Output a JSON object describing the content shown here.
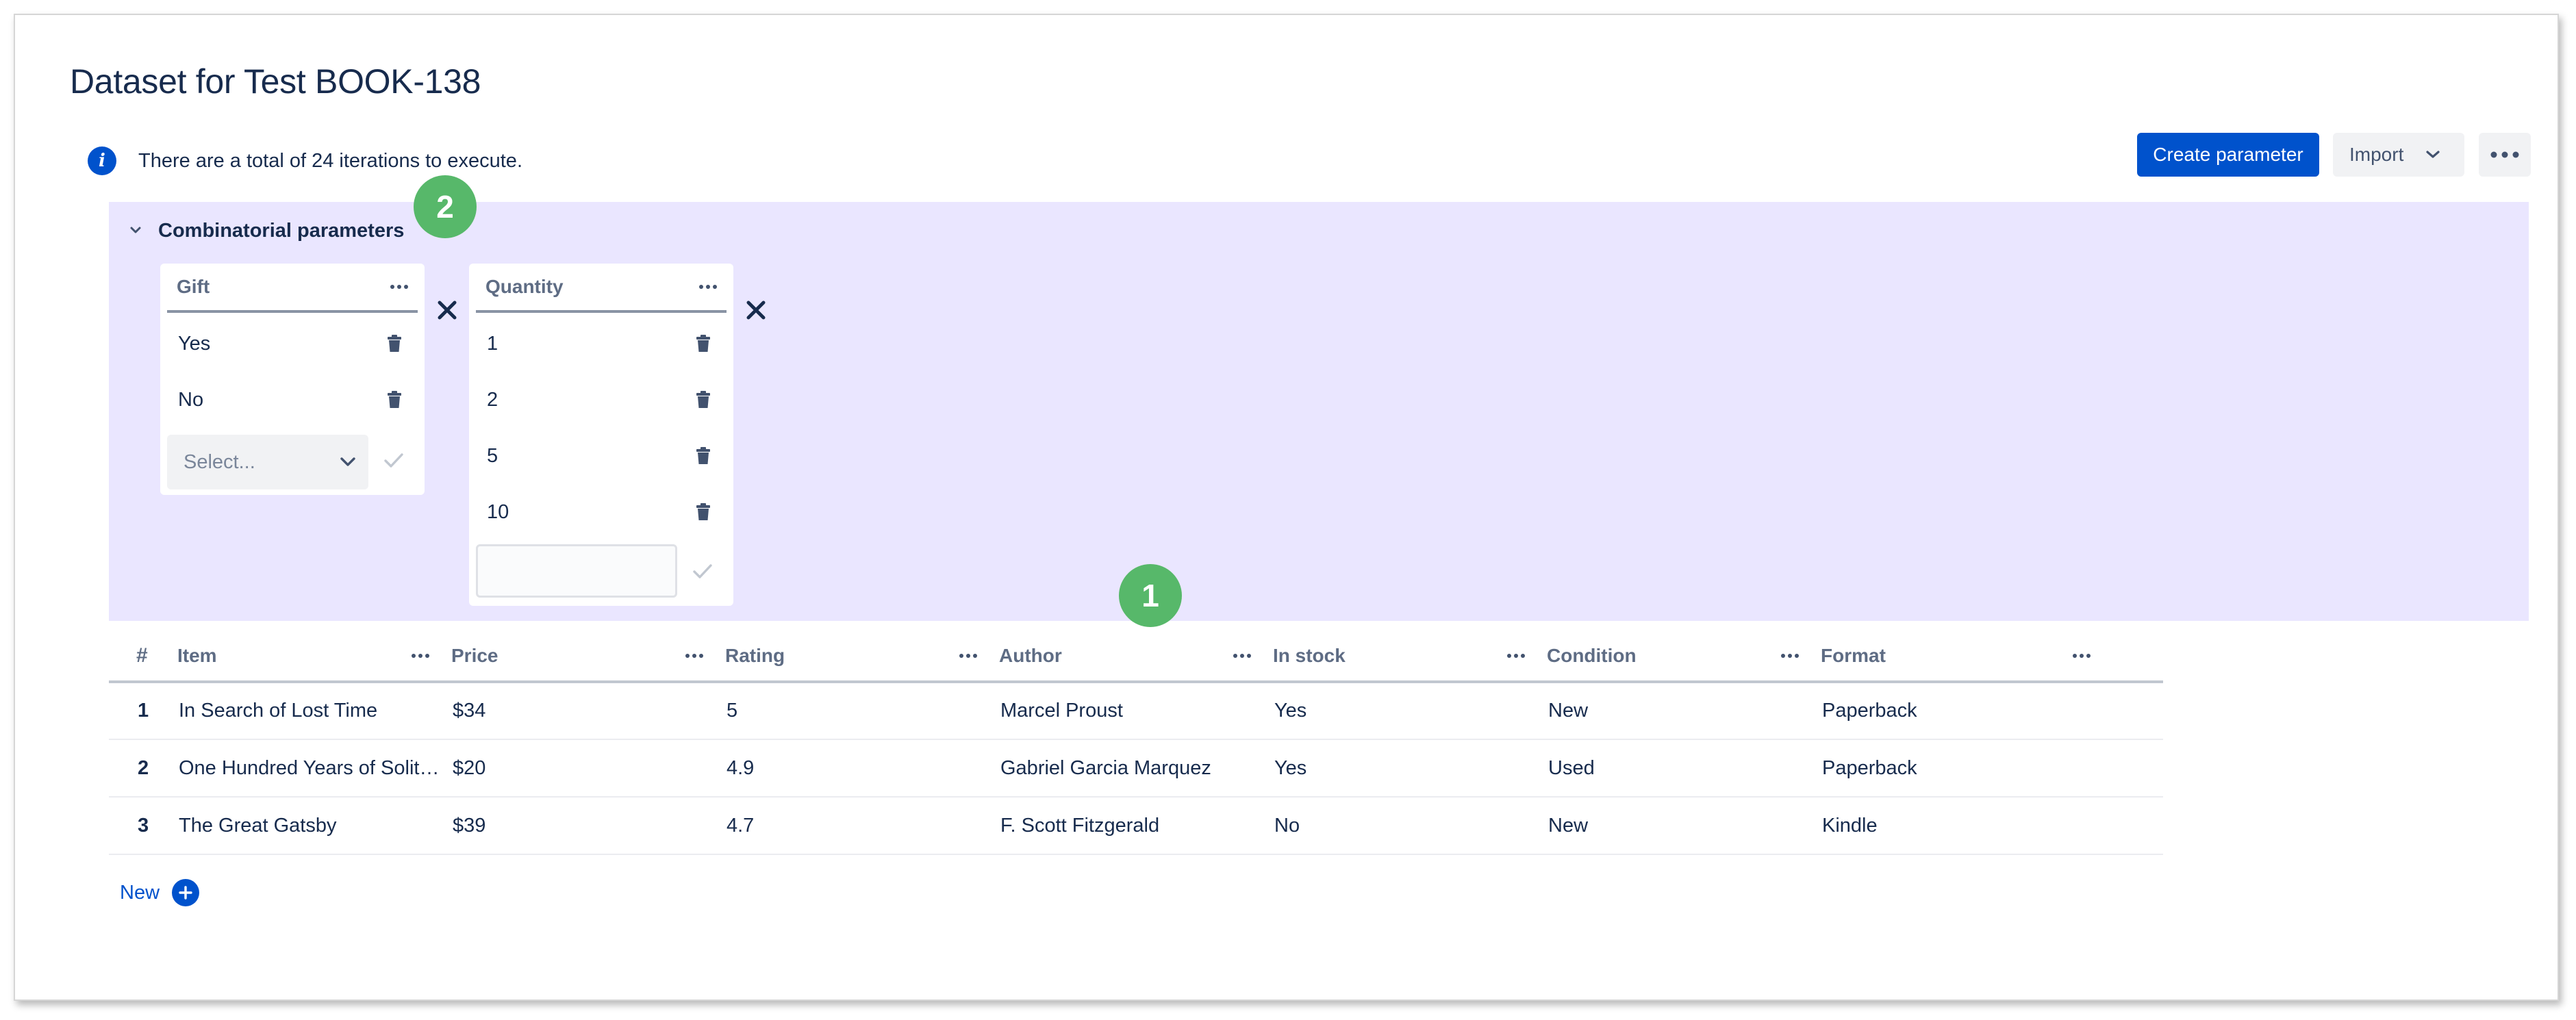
{
  "page": {
    "title": "Dataset for Test BOOK-138",
    "info_text": "There are a total of 24 iterations to execute."
  },
  "toolbar": {
    "create_parameter_label": "Create parameter",
    "import_label": "Import"
  },
  "combinatorial": {
    "title": "Combinatorial parameters",
    "parameters": [
      {
        "name": "Gift",
        "values": [
          "Yes",
          "No"
        ],
        "select_placeholder": "Select..."
      },
      {
        "name": "Quantity",
        "values": [
          "1",
          "2",
          "5",
          "10"
        ],
        "input_value": ""
      }
    ]
  },
  "badges": [
    "1",
    "2"
  ],
  "table": {
    "index_header": "#",
    "columns": [
      "Item",
      "Price",
      "Rating",
      "Author",
      "In stock",
      "Condition",
      "Format"
    ],
    "rows": [
      {
        "index": "1",
        "cells": [
          "In Search of Lost Time",
          "$34",
          "5",
          "Marcel Proust",
          "Yes",
          "New",
          "Paperback"
        ]
      },
      {
        "index": "2",
        "cells": [
          "One Hundred Years of Solitude",
          "$20",
          "4.9",
          "Gabriel Garcia Marquez",
          "Yes",
          "Used",
          "Paperback"
        ]
      },
      {
        "index": "3",
        "cells": [
          "The Great Gatsby",
          "$39",
          "4.7",
          "F. Scott Fitzgerald",
          "No",
          "New",
          "Kindle"
        ]
      }
    ],
    "new_label": "New"
  },
  "colors": {
    "primary": "#0052cc",
    "panel_background": "#eae6ff",
    "badge": "#57b86a"
  },
  "icons": [
    "info-icon",
    "chevron-down-icon",
    "more-icon",
    "trash-icon",
    "check-icon",
    "times-icon",
    "plus-icon"
  ]
}
